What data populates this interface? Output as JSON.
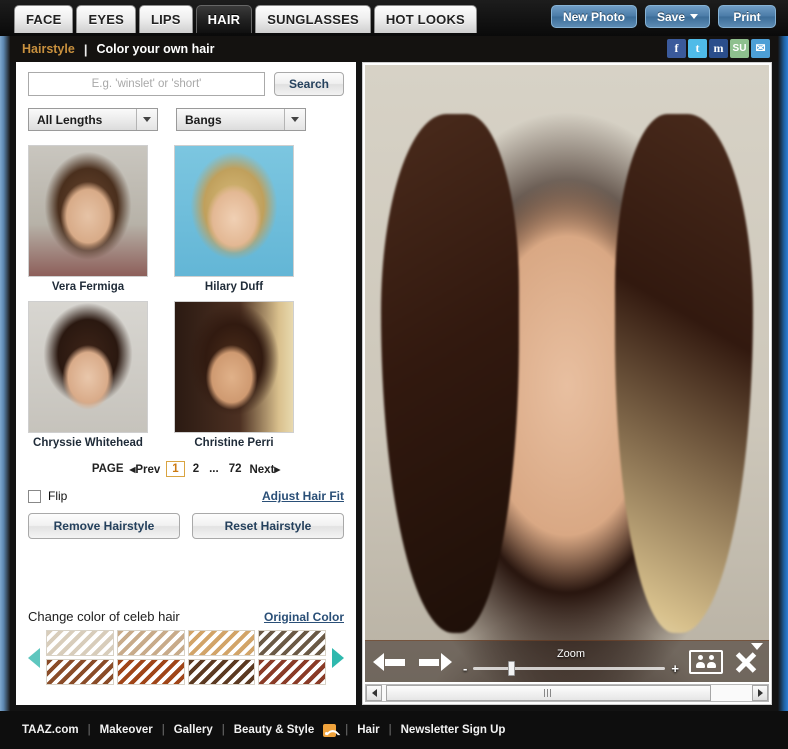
{
  "nav": {
    "tabs": [
      {
        "label": "FACE",
        "active": false
      },
      {
        "label": "EYES",
        "active": false
      },
      {
        "label": "LIPS",
        "active": false
      },
      {
        "label": "HAIR",
        "active": true
      },
      {
        "label": "SUNGLASSES",
        "active": false
      },
      {
        "label": "HOT LOOKS",
        "active": false
      }
    ],
    "actions": {
      "new_photo": "New Photo",
      "save": "Save",
      "print": "Print"
    }
  },
  "subheader": {
    "section": "Hairstyle",
    "separator": "|",
    "title": "Color your own hair",
    "social": [
      {
        "name": "facebook-icon",
        "glyph": "f"
      },
      {
        "name": "twitter-icon",
        "glyph": "t"
      },
      {
        "name": "myspace-icon",
        "glyph": "m"
      },
      {
        "name": "stumbleupon-icon",
        "glyph": "SU"
      },
      {
        "name": "email-icon",
        "glyph": "✉"
      }
    ]
  },
  "search": {
    "value": "",
    "placeholder": "E.g. 'winslet' or 'short'",
    "button_label": "Search"
  },
  "filters": [
    {
      "name": "length-filter",
      "value": "All Lengths"
    },
    {
      "name": "style-filter",
      "value": "Bangs"
    }
  ],
  "thumbnails": [
    {
      "name": "Vera Fermiga"
    },
    {
      "name": "Hilary Duff"
    },
    {
      "name": "Chryssie Whitehead"
    },
    {
      "name": "Christine Perri"
    }
  ],
  "pagination": {
    "label": "PAGE",
    "prev": "◂Prev",
    "pages": [
      "1",
      "2",
      "...",
      "72"
    ],
    "current": "1",
    "next": "Next▸"
  },
  "options": {
    "flip_label": "Flip",
    "flip_checked": false,
    "adjust_link": "Adjust Hair Fit",
    "remove_button": "Remove Hairstyle",
    "reset_button": "Reset Hairstyle"
  },
  "color_section": {
    "title": "Change color of celeb hair",
    "original_link": "Original Color",
    "prev_arrow": "prev-colors-arrow",
    "next_arrow": "next-colors-arrow",
    "swatches": [
      {
        "name": "platinum-blonde",
        "hex": "#d8cdbb"
      },
      {
        "name": "light-ash-blonde",
        "hex": "#c8ab8a"
      },
      {
        "name": "golden-blonde",
        "hex": "#d2a468"
      },
      {
        "name": "dark-ash-brown",
        "hex": "#6b5a46"
      },
      {
        "name": "medium-auburn",
        "hex": "#8a4c28"
      },
      {
        "name": "copper-red",
        "hex": "#a04518"
      },
      {
        "name": "dark-brown",
        "hex": "#5c3a22"
      },
      {
        "name": "deep-burgundy",
        "hex": "#8a3b27"
      }
    ]
  },
  "photo_toolbar": {
    "back": "back-arrow",
    "forward": "forward-arrow",
    "zoom_label": "Zoom",
    "zoom_minus": "-",
    "zoom_plus": "+",
    "zoom_value": 18,
    "compare": "compare-icon",
    "close": "close-icon",
    "collapse": "collapse-caret"
  },
  "footer": {
    "links": [
      "TAAZ.com",
      "Makeover",
      "Gallery",
      "Beauty & Style",
      "Hair",
      "Newsletter Sign Up"
    ],
    "rss_after": "Beauty & Style",
    "separator": "|"
  }
}
